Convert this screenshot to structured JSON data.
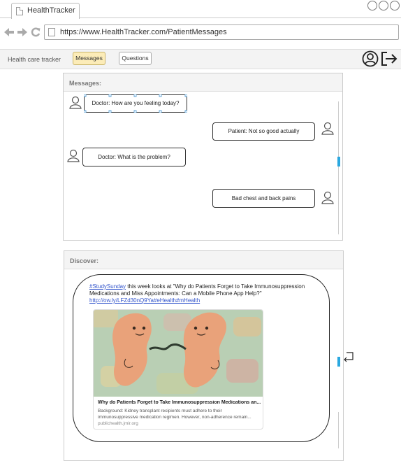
{
  "browser": {
    "tab_title": "HealthTracker",
    "url": "https://www.HealthTracker.com/PatientMessages"
  },
  "nav": {
    "tracker": "Health care tracker",
    "messages": "Messages",
    "questions": "Questions"
  },
  "messages": {
    "heading": "Messages:",
    "items": [
      {
        "sender": "doctor",
        "text": "Doctor: How are you feeling today?"
      },
      {
        "sender": "patient",
        "text": "Patient: Not so good actually"
      },
      {
        "sender": "doctor",
        "text": "Doctor: What is the problem?"
      },
      {
        "sender": "patient",
        "text": "Bad chest and back pains"
      }
    ]
  },
  "discover": {
    "heading": "Discover:",
    "hashtag": "#StudySunday",
    "tweet_text": " this week looks at \"Why do Patients Forget to Take Immunosuppression Medications and Miss Appointments: Can a Mobile Phone App Help?\"",
    "tweet_link": "http://ow.ly/LFZd30nQ9Ya#eHealth#mHealth",
    "preview_title": "Why do Patients Forget to Take Immunosuppression Medications an...",
    "preview_desc": "Background: Kidney transplant recipients must adhere to their immunosuppressive medication regimen. However, non-adherence remain...",
    "preview_source": "publichealth.jmir.org"
  },
  "colors": {
    "active_tab": "#fcecb8",
    "scroll_thumb": "#2aa8e0",
    "link": "#3355cc"
  }
}
